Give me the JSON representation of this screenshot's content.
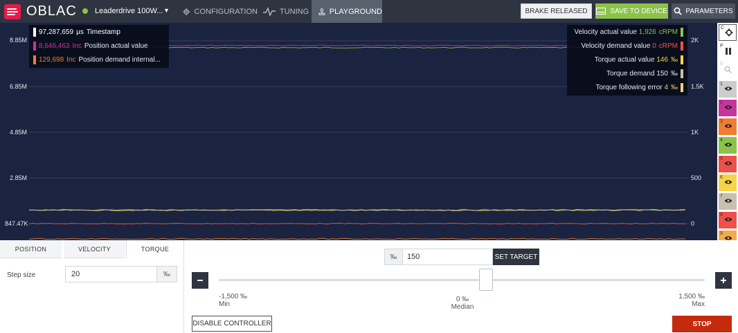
{
  "app": {
    "brand": "OBLAC",
    "device_name": "Leaderdrive 100W...",
    "device_status_color": "#8bc34a"
  },
  "nav": {
    "configuration": "CONFIGURATION",
    "tuning": "TUNING",
    "playground": "PLAYGROUND",
    "active": "playground"
  },
  "header_buttons": {
    "brake": "BRAKE RELEASED",
    "save": "SAVE TO DEVICE",
    "parameters": "PARAMETERS"
  },
  "chart_data": {
    "type": "line",
    "left_axis_ticks": [
      "8.85M",
      "6.85M",
      "4.85M",
      "2.85M",
      "847.47K"
    ],
    "right_axis_ticks": [
      "2K",
      "1.5K",
      "1K",
      "500",
      "0"
    ],
    "left_legend": [
      {
        "value": "97,287,659",
        "unit": "µs",
        "label": "Timestamp",
        "color": "#ffffff"
      },
      {
        "value": "8,646,463",
        "unit": "Inc",
        "label": "Position actual value",
        "color": "#c7359c"
      },
      {
        "value": "129,698",
        "unit": "Inc",
        "label": "Position demand internal...",
        "color": "#f07d31"
      }
    ],
    "right_legend": [
      {
        "label": "Velocity actual value",
        "value": "1,926",
        "unit": "cRPM",
        "color": "#8bc34a"
      },
      {
        "label": "Velocity demand value",
        "value": "0",
        "unit": "cRPM",
        "color": "#f0504a"
      },
      {
        "label": "Torque actual value",
        "value": "146",
        "unit": "‰",
        "color": "#f5d547"
      },
      {
        "label": "Torque demand",
        "value": "150",
        "unit": "‰",
        "color": "#c8bfb0"
      },
      {
        "label": "Torque following error",
        "value": "4",
        "unit": "‰",
        "color": "#f5cf7a"
      }
    ],
    "left_ylim": [
      847470,
      8850000
    ],
    "right_ylim": [
      0,
      2000
    ],
    "series": [
      {
        "name": "Velocity actual value",
        "level": 1926,
        "axis": "right",
        "color": "#8bc34a"
      },
      {
        "name": "Position actual value",
        "level": 8646463,
        "axis": "left",
        "color": "#c7359c"
      },
      {
        "name": "Torque actual value",
        "level": 146,
        "axis": "right",
        "color": "#f5d547"
      },
      {
        "name": "Torque demand",
        "level": 150,
        "axis": "right",
        "color": "#c8bfb0"
      },
      {
        "name": "Velocity demand value",
        "level": 0,
        "axis": "right",
        "color": "#f0504a"
      },
      {
        "name": "Position demand internal...",
        "level": 129698,
        "axis": "left",
        "color": "#f07d31"
      }
    ]
  },
  "rail": {
    "items": [
      {
        "num": "C",
        "icon": "gear-icon"
      },
      {
        "num": "P",
        "icon": "pause-icon"
      },
      {
        "num": "0",
        "icon": "search-icon"
      },
      {
        "num": "1",
        "color": "#cccccc"
      },
      {
        "num": "2",
        "color": "#c7359c"
      },
      {
        "num": "3",
        "color": "#f07d31"
      },
      {
        "num": "4",
        "color": "#8bc34a"
      },
      {
        "num": "5",
        "color": "#f0504a"
      },
      {
        "num": "6",
        "color": "#f5d547"
      },
      {
        "num": "7",
        "color": "#c8bfb0"
      },
      {
        "num": "8",
        "color": "#f0504a"
      },
      {
        "num": "9",
        "color": "#f5a94a"
      }
    ]
  },
  "tabs": {
    "position": "POSITION",
    "velocity": "VELOCITY",
    "torque": "TORQUE",
    "active": "torque"
  },
  "step": {
    "label": "Step size",
    "value": "20",
    "unit": "‰"
  },
  "target": {
    "unit": "‰",
    "value": "150",
    "set_label": "SET TARGET"
  },
  "slider": {
    "min_value": "-1,500 ‰",
    "min_label": "Min",
    "median_value": "0 ‰",
    "median_label": "Median",
    "max_value": "1,500 ‰",
    "max_label": "Max",
    "min": -1500,
    "max": 1500,
    "value": 150
  },
  "controls": {
    "disable": "DISABLE CONTROLLER",
    "stop": "STOP"
  }
}
